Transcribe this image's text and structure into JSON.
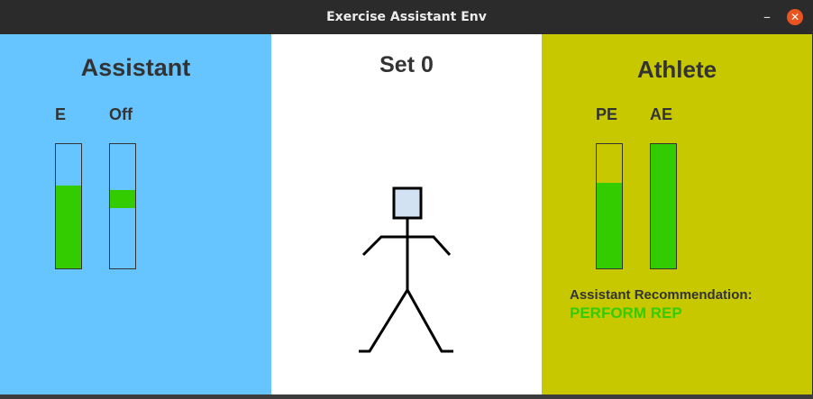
{
  "window": {
    "title": "Exercise Assistant Env",
    "minimize_glyph": "–",
    "close_glyph": "✕"
  },
  "colors": {
    "assistant_bg": "#66c5ff",
    "athlete_bg": "#c8c800",
    "center_bg": "#ffffff",
    "bar_fill": "#33cc00",
    "bar_track_left": "#66c5ff",
    "bar_track_right": "#c8c800",
    "recommendation": "#33cc00",
    "figure_head": "#d2e2f2"
  },
  "assistant": {
    "title": "Assistant",
    "bars": [
      {
        "label": "E",
        "level": 0.67,
        "style": "fill"
      },
      {
        "label": "Off",
        "level": 0.56,
        "style": "marker"
      }
    ]
  },
  "center": {
    "title": "Set 0"
  },
  "athlete": {
    "title": "Athlete",
    "bars": [
      {
        "label": "PE",
        "level": 0.69,
        "style": "fill"
      },
      {
        "label": "AE",
        "level": 1.0,
        "style": "fill"
      }
    ],
    "recommendation_label": "Assistant Recommendation:",
    "recommendation_value": "PERFORM REP"
  }
}
